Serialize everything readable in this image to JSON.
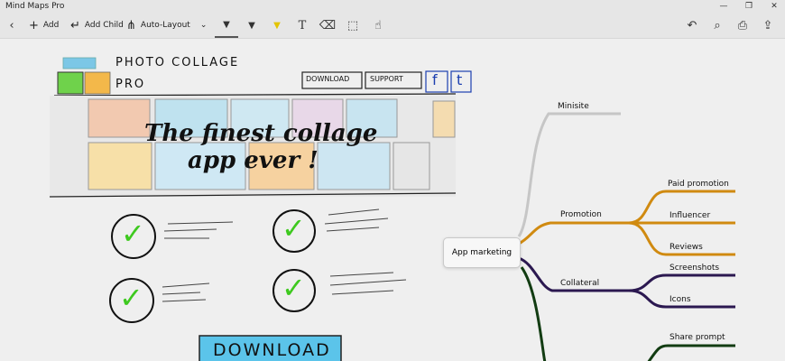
{
  "window": {
    "title": "Mind Maps Pro",
    "controls": {
      "minimize": "—",
      "restore": "❐",
      "close": "✕"
    }
  },
  "toolbar": {
    "back_icon": "‹",
    "add_label": "Add",
    "add_child_label": "Add Child",
    "auto_layout_label": "Auto-Layout",
    "chevron": "⌄",
    "tools": {
      "pen": "▼",
      "pencil": "▼",
      "highlighter": "▼",
      "text": "T",
      "eraser": "⌫",
      "lasso": "⬚",
      "touch": "☝"
    },
    "right": {
      "undo": "↶",
      "search": "⌕",
      "print": "⎙",
      "share": "⇪"
    }
  },
  "sketch": {
    "app_name_line1": "PHOTO COLLAGE",
    "app_name_line2": "PRO",
    "nav_download": "DOWNLOAD",
    "nav_support": "SUPPORT",
    "facebook": "f",
    "twitter": "t",
    "headline_line1": "The finest collage",
    "headline_line2": "app ever !",
    "cta": "DOWNLOAD",
    "check": "✓"
  },
  "mindmap": {
    "root": "App marketing",
    "branches": [
      {
        "label": "Minisite",
        "color": "#c6c6c6",
        "children": []
      },
      {
        "label": "Promotion",
        "color": "#d08a10",
        "children": [
          "Paid promotion",
          "Influencer",
          "Reviews"
        ]
      },
      {
        "label": "Collateral",
        "color": "#2b1850",
        "children": [
          "Screenshots",
          "Icons"
        ]
      },
      {
        "label": "",
        "color": "#123c12",
        "children": [
          "Share prompt"
        ]
      }
    ]
  }
}
